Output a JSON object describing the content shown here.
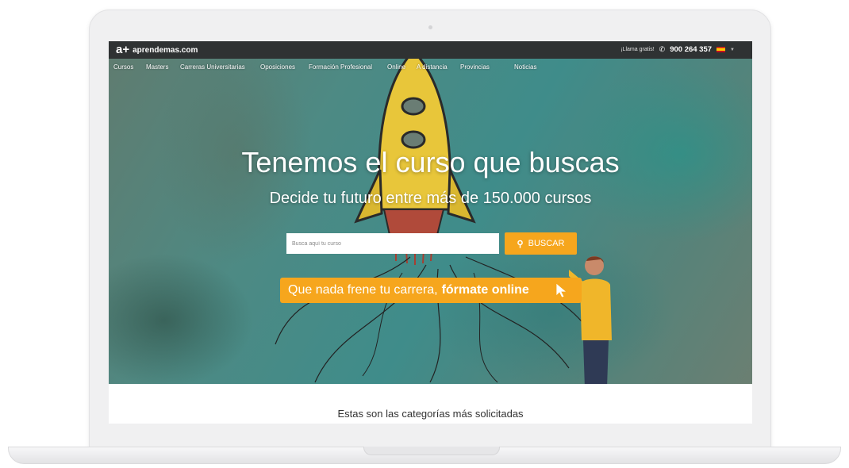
{
  "site": {
    "logo_mark": "a+",
    "logo_text": "aprendemas.com"
  },
  "topbar": {
    "call_label": "¡Llama gratis!",
    "phone_icon": "phone-icon",
    "phone_number": "900 264 357",
    "language_flag": "spain-flag-icon"
  },
  "nav": {
    "items": [
      "Cursos",
      "Masters",
      "Carreras Universitarias",
      "Oposiciones",
      "Formación Profesional",
      "Online",
      "A distancia",
      "Provincias",
      "Noticias"
    ]
  },
  "hero": {
    "title": "Tenemos el curso que buscas",
    "subtitle": "Decide tu futuro entre más de 150.000 cursos",
    "search_placeholder": "Busca aquí tu curso",
    "search_button": "BUSCAR",
    "cta_normal": "Que nada frene tu carrera,",
    "cta_bold": "fórmate online"
  },
  "sections": {
    "categories_title": "Estas son las categorías más solicitadas"
  },
  "colors": {
    "accent": "#f6a61d",
    "topbar": "#2f3233"
  }
}
